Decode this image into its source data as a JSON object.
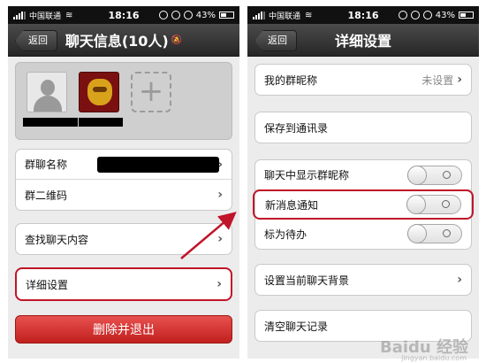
{
  "status_left": {
    "carrier": "中国联通",
    "time": "18:16",
    "battery": "43%"
  },
  "status_right": {
    "carrier": "中国联通",
    "time": "18:16",
    "battery": "43%"
  },
  "left": {
    "back_label": "返回",
    "title": "聊天信息(10人)",
    "rows_group1": [
      {
        "label": "群聊名称"
      },
      {
        "label": "群二维码"
      }
    ],
    "search_label": "查找聊天内容",
    "settings_label": "详细设置",
    "delete_label": "删除并退出"
  },
  "right": {
    "back_label": "返回",
    "title": "详细设置",
    "nickname_label": "我的群昵称",
    "nickname_value": "未设置",
    "save_label": "保存到通讯录",
    "show_nick_label": "聊天中显示群昵称",
    "notify_label": "新消息通知",
    "todo_label": "标为待办",
    "background_label": "设置当前聊天背景",
    "clear_label": "清空聊天记录"
  },
  "watermark": {
    "brand": "Baidu 经验",
    "url": "jingyan.baidu.com"
  },
  "colors": {
    "highlight": "#c0152a",
    "delete_button": "#d33a38",
    "navbar": "#333333"
  }
}
